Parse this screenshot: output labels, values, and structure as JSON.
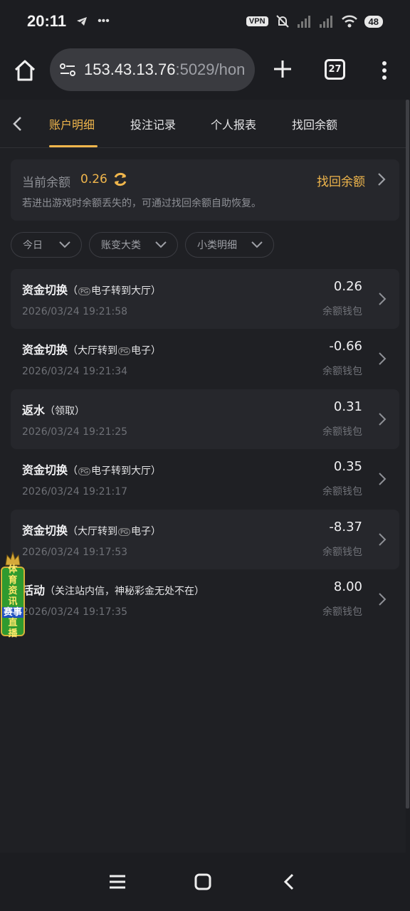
{
  "status_bar": {
    "time": "20:11",
    "left_icons": [
      "telegram-icon",
      "more-dots-icon"
    ],
    "vpn": "VPN",
    "battery": "48"
  },
  "browser": {
    "url_host": "153.43.13.76",
    "url_rest": ":5029/hon",
    "tab_count": "27"
  },
  "nav": {
    "tabs": [
      {
        "label": "账户明细",
        "active": true
      },
      {
        "label": "投注记录",
        "active": false
      },
      {
        "label": "个人报表",
        "active": false
      },
      {
        "label": "找回余额",
        "active": false
      }
    ]
  },
  "balance": {
    "label": "当前余额",
    "value": "0.26",
    "recover_label": "找回余额",
    "hint": "若进出游戏时余额丢失的，可通过找回余额自助恢复。"
  },
  "filters": [
    {
      "label": "今日"
    },
    {
      "label": "账变大类"
    },
    {
      "label": "小类明细"
    }
  ],
  "records": [
    {
      "title": "资金切换",
      "sub_pre": "（",
      "sub_logo": "PG",
      "sub_post": "电子转到大厅）",
      "time": "2026/03/24 19:21:58",
      "amount": "0.26",
      "wallet": "余额钱包"
    },
    {
      "title": "资金切换",
      "sub_pre": "（大厅转到",
      "sub_logo": "PG",
      "sub_post": "电子）",
      "time": "2026/03/24 19:21:34",
      "amount": "-0.66",
      "wallet": "余额钱包"
    },
    {
      "title": "返水",
      "sub_pre": "（领取）",
      "sub_logo": "",
      "sub_post": "",
      "time": "2026/03/24 19:21:25",
      "amount": "0.31",
      "wallet": "余额钱包"
    },
    {
      "title": "资金切换",
      "sub_pre": "（",
      "sub_logo": "PG",
      "sub_post": "电子转到大厅）",
      "time": "2026/03/24 19:21:17",
      "amount": "0.35",
      "wallet": "余额钱包"
    },
    {
      "title": "资金切换",
      "sub_pre": "（大厅转到",
      "sub_logo": "PG",
      "sub_post": "电子）",
      "time": "2026/03/24 19:17:53",
      "amount": "-8.37",
      "wallet": "余额钱包"
    },
    {
      "title": "活动",
      "sub_pre": "（关注站内信，神秘彩金无处不在）",
      "sub_logo": "",
      "sub_post": "",
      "time": "2026/03/24 19:17:35",
      "amount": "8.00",
      "wallet": "余额钱包"
    }
  ],
  "float_badge": {
    "top": "体育资讯",
    "middle": "赛事",
    "bottom": "直播"
  },
  "colors": {
    "accent": "#f0b64c",
    "background": "#1f2024",
    "card": "#26272c"
  }
}
